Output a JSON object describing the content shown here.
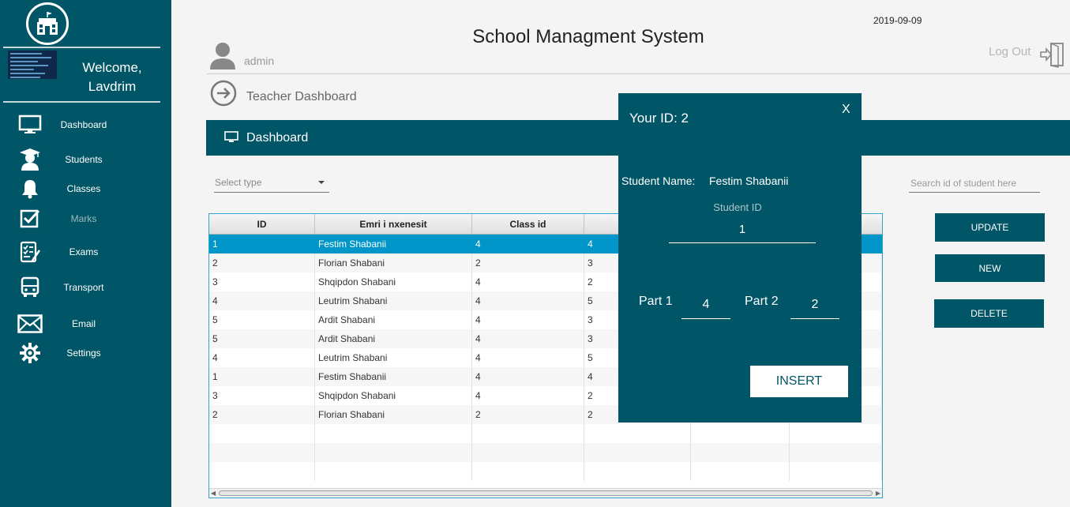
{
  "header": {
    "title": "School Managment System",
    "date": "2019-09-09",
    "username": "admin",
    "logout_label": "Log Out",
    "breadcrumb": "Teacher Dashboard"
  },
  "sidebar": {
    "welcome_line1": "Welcome,",
    "welcome_line2": "Lavdrim",
    "items": [
      {
        "label": "Dashboard",
        "icon": "monitor-icon"
      },
      {
        "label": "Students",
        "icon": "graduate-icon"
      },
      {
        "label": "Classes",
        "icon": "bell-icon"
      },
      {
        "label": "Marks",
        "icon": "checkbox-icon"
      },
      {
        "label": "Exams",
        "icon": "checklist-icon"
      },
      {
        "label": "Transport",
        "icon": "bus-icon"
      },
      {
        "label": "Email",
        "icon": "envelope-icon"
      },
      {
        "label": "Settings",
        "icon": "gear-icon"
      }
    ]
  },
  "dashboard_bar": {
    "label": "Dashboard"
  },
  "filters": {
    "select_type_placeholder": "Select type",
    "search_placeholder": "Search id of student here"
  },
  "table": {
    "columns": [
      "ID",
      "Emri i nxenesit",
      "Class id",
      "",
      "",
      ""
    ],
    "rows": [
      [
        "1",
        "Festim Shabanii",
        "4",
        "4"
      ],
      [
        "2",
        "Florian Shabani",
        "2",
        "3"
      ],
      [
        "3",
        "Shqipdon Shabani",
        "4",
        "2"
      ],
      [
        "4",
        "Leutrim Shabani",
        "4",
        "5"
      ],
      [
        "5",
        "Ardit Shabani",
        "4",
        "3"
      ],
      [
        "5",
        "Ardit Shabani",
        "4",
        "3"
      ],
      [
        "4",
        "Leutrim Shabani",
        "4",
        "5"
      ],
      [
        "1",
        "Festim Shabanii",
        "4",
        "4"
      ],
      [
        "3",
        "Shqipdon Shabani",
        "4",
        "2"
      ],
      [
        "2",
        "Florian Shabani",
        "2",
        "2"
      ]
    ]
  },
  "buttons": {
    "update": "UPDATE",
    "new": "NEW",
    "delete": "DELETE"
  },
  "modal": {
    "title": "Your ID: 2",
    "close": "X",
    "student_name_label": "Student Name:",
    "student_name_value": "Festim Shabanii",
    "student_id_label": "Student ID",
    "student_id_value": "1",
    "part1_label": "Part 1",
    "part1_value": "4",
    "part2_label": "Part 2",
    "part2_value": "2",
    "insert_label": "INSERT"
  },
  "colors": {
    "primary": "#005566",
    "selected_row": "#0096c9",
    "background": "#f4f4f4"
  }
}
